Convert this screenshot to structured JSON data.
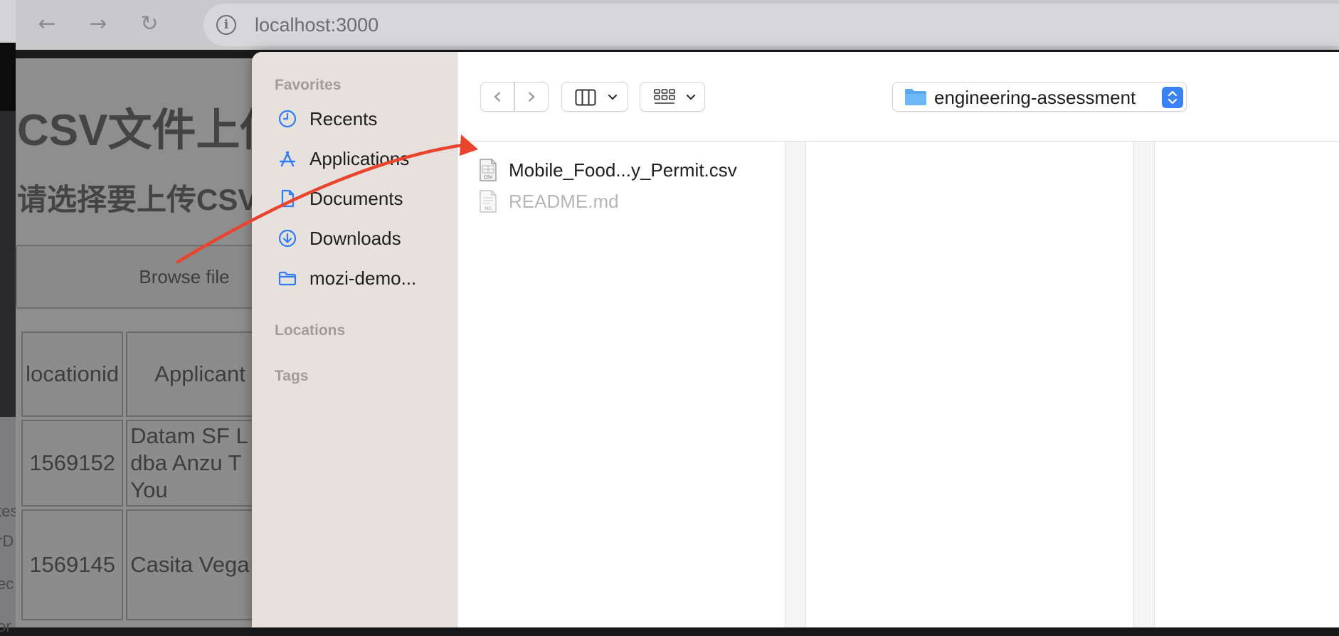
{
  "browser": {
    "url": "localhost:3000",
    "back_glyph": "←",
    "forward_glyph": "→",
    "reload_glyph": "↻",
    "info_glyph": "i"
  },
  "page": {
    "title": "CSV文件上传",
    "subtitle": "请选择要上传CSV",
    "browse_label": "Browse file",
    "table": {
      "header": [
        "locationid",
        "Applicant"
      ],
      "rows": [
        [
          "1569152",
          "Datam SF L dba Anzu T You"
        ],
        [
          "1569145",
          "Casita Vega"
        ]
      ]
    }
  },
  "edge_fragments": [
    "tes",
    "rD",
    "ec",
    "or"
  ],
  "finder": {
    "sidebar": {
      "favorites_heading": "Favorites",
      "items": [
        {
          "label": "Recents",
          "icon": "clock-icon"
        },
        {
          "label": "Applications",
          "icon": "applications-icon"
        },
        {
          "label": "Documents",
          "icon": "document-icon"
        },
        {
          "label": "Downloads",
          "icon": "download-icon"
        },
        {
          "label": "mozi-demo...",
          "icon": "folder-icon"
        }
      ],
      "locations_heading": "Locations",
      "tags_heading": "Tags"
    },
    "toolbar": {
      "back_glyph": "‹",
      "forward_glyph": "›",
      "folder_name": "engineering-assessment"
    },
    "files": [
      {
        "name": "Mobile_Food...y_Permit.csv",
        "type": "csv",
        "enabled": true,
        "badge": "CSV"
      },
      {
        "name": "README.md",
        "type": "md",
        "enabled": false,
        "badge": "MD"
      }
    ]
  },
  "colors": {
    "accent": "#3a82f6",
    "arrow": "#e8442e",
    "sidebar_bg": "#e6e1dd",
    "icon_blue": "#2f7bf5"
  }
}
